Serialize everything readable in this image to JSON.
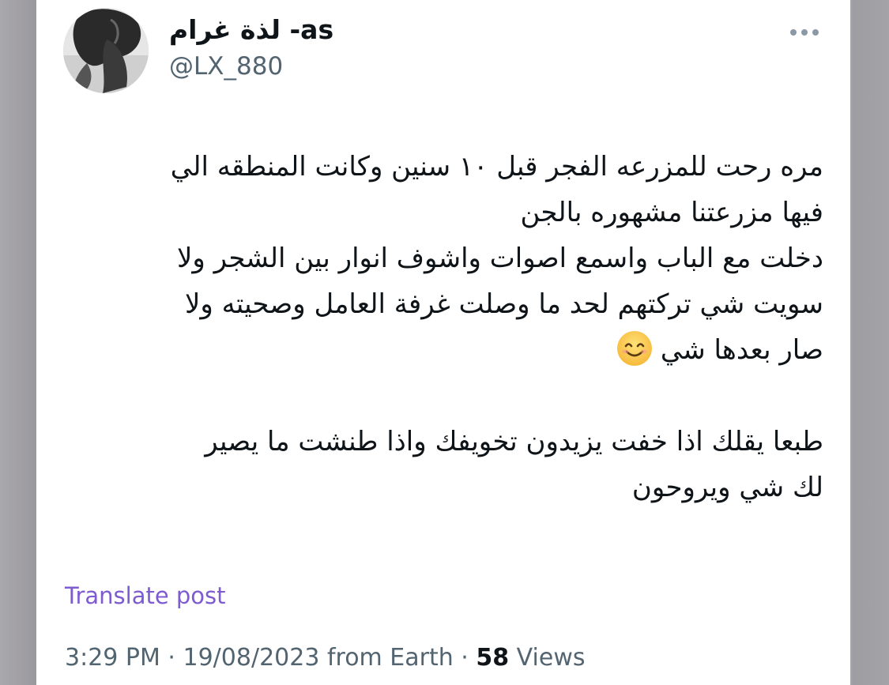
{
  "author": {
    "display_name": "لذة غرام -as",
    "handle": "@LX_880",
    "avatar_icon": "profile-photo"
  },
  "menu": {
    "more_icon": "ellipsis-horizontal-icon"
  },
  "post": {
    "lines": [
      "مره رحت للمزرعه الفجر قبل ١٠ سنين وكانت المنطقه الي",
      "فيها مزرعتنا مشهوره بالجن",
      "دخلت مع الباب واسمع اصوات واشوف انوار بين الشجر ولا",
      "سويت شي تركتهم لحد ما وصلت غرفة العامل وصحيته ولا",
      "صار بعدها شي",
      "",
      "طبعا يقلك اذا خفت يزيدون تخويفك واذا طنشت ما يصير",
      "لك شي ويروحون"
    ],
    "emoji": "smiling-face-with-smiling-eyes"
  },
  "translate": {
    "label": "Translate post",
    "color": "#7e5bd1"
  },
  "meta": {
    "time": "3:29 PM",
    "separator": " · ",
    "date": "19/08/2023",
    "source": " from Earth",
    "views_count": "58",
    "views_label": " Views"
  }
}
